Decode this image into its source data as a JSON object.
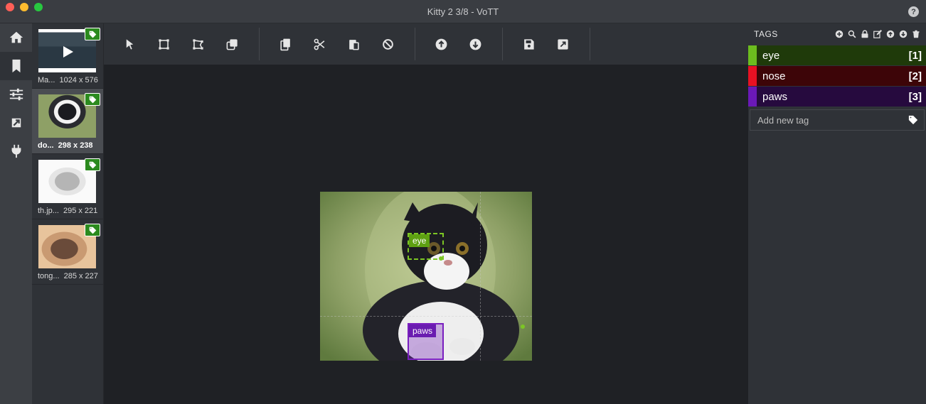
{
  "window": {
    "title": "Kitty 2 3/8 - VoTT"
  },
  "nav": {
    "items": [
      {
        "icon": "home-icon"
      },
      {
        "icon": "bookmark-icon"
      },
      {
        "icon": "sliders-icon"
      },
      {
        "icon": "export-icon"
      },
      {
        "icon": "plug-icon"
      }
    ]
  },
  "thumbnails": [
    {
      "name": "Ma...",
      "size": "1024 x 576",
      "tagged": true,
      "video": true
    },
    {
      "name": "do...",
      "size": "298 x 238",
      "tagged": true,
      "active": true
    },
    {
      "name": "th.jp...",
      "size": "295 x 221",
      "tagged": true
    },
    {
      "name": "tong...",
      "size": "285 x 227",
      "tagged": true
    }
  ],
  "toolbar": {
    "groups": [
      [
        "pointer-icon",
        "rectangle-icon",
        "polygon-icon",
        "copy-rectangle-icon"
      ],
      [
        "copy-icon",
        "cut-icon",
        "paste-icon",
        "clear-icon"
      ],
      [
        "previous-icon",
        "next-icon"
      ],
      [
        "save-icon",
        "export-icon"
      ]
    ]
  },
  "canvas": {
    "regions": [
      {
        "tag": "eye",
        "color": "#7cc624"
      },
      {
        "tag": "paws",
        "color": "#7a1fbf"
      }
    ]
  },
  "tags_panel": {
    "title": "TAGS",
    "icons": [
      "add-icon",
      "search-icon",
      "lock-icon",
      "edit-icon",
      "move-up-icon",
      "move-down-icon",
      "delete-icon"
    ],
    "tags": [
      {
        "name": "eye",
        "key": "[1]",
        "color": "#6cbd1e",
        "bg": "#1f3a0a"
      },
      {
        "name": "nose",
        "key": "[2]",
        "color": "#e81123",
        "bg": "#3d0508"
      },
      {
        "name": "paws",
        "key": "[3]",
        "color": "#6b19b8",
        "bg": "#260a3e"
      }
    ],
    "add_placeholder": "Add new tag"
  }
}
